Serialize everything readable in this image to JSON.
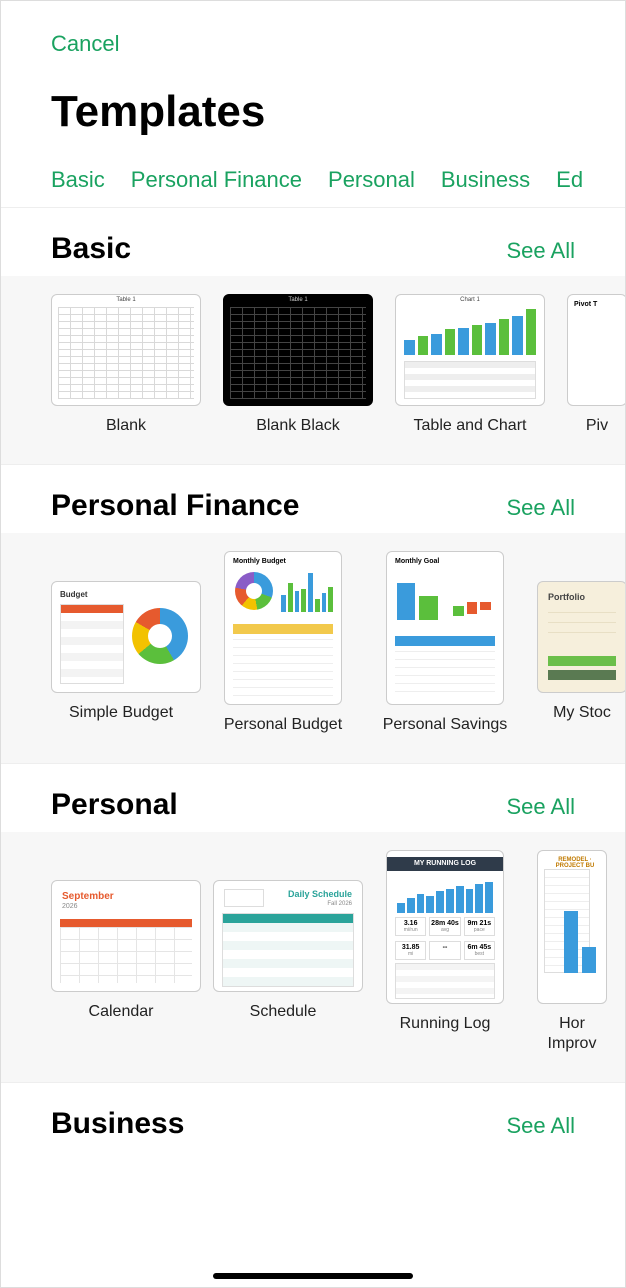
{
  "header": {
    "cancel": "Cancel",
    "title": "Templates"
  },
  "tabs": [
    "Basic",
    "Personal Finance",
    "Personal",
    "Business",
    "Ed"
  ],
  "see_all": "See All",
  "sections": {
    "basic": {
      "title": "Basic",
      "items": [
        {
          "label": "Blank",
          "thumb_title": "Table 1"
        },
        {
          "label": "Blank Black",
          "thumb_title": "Table 1"
        },
        {
          "label": "Table and Chart",
          "thumb_title": "Chart 1"
        },
        {
          "label": "Piv",
          "thumb_title": "Pivot T"
        }
      ]
    },
    "personal_finance": {
      "title": "Personal Finance",
      "items": [
        {
          "label": "Simple Budget",
          "thumb_title": "Budget"
        },
        {
          "label": "Personal Budget",
          "thumb_title": "Monthly Budget"
        },
        {
          "label": "Personal Savings",
          "thumb_title": "Monthly Goal"
        },
        {
          "label": "My Stoc",
          "thumb_title": "Portfolio"
        }
      ]
    },
    "personal": {
      "title": "Personal",
      "items": [
        {
          "label": "Calendar",
          "thumb_title": "September",
          "thumb_sub": "2026"
        },
        {
          "label": "Schedule",
          "thumb_title": "Daily Schedule",
          "thumb_sub": "Fall 2026"
        },
        {
          "label": "Running Log",
          "thumb_title": "MY RUNNING LOG",
          "stats": [
            {
              "v": "3.16",
              "u": "mi/run"
            },
            {
              "v": "28m 40s",
              "u": "avg"
            },
            {
              "v": "9m 21s",
              "u": "pace"
            },
            {
              "v": "31.85",
              "u": "mi"
            },
            {
              "v": "--",
              "u": ""
            },
            {
              "v": "6m 45s",
              "u": "best"
            }
          ]
        },
        {
          "label": "Hor\nImprov",
          "thumb_title": "REMODEL · PROJECT BU"
        }
      ]
    },
    "business": {
      "title": "Business"
    }
  }
}
